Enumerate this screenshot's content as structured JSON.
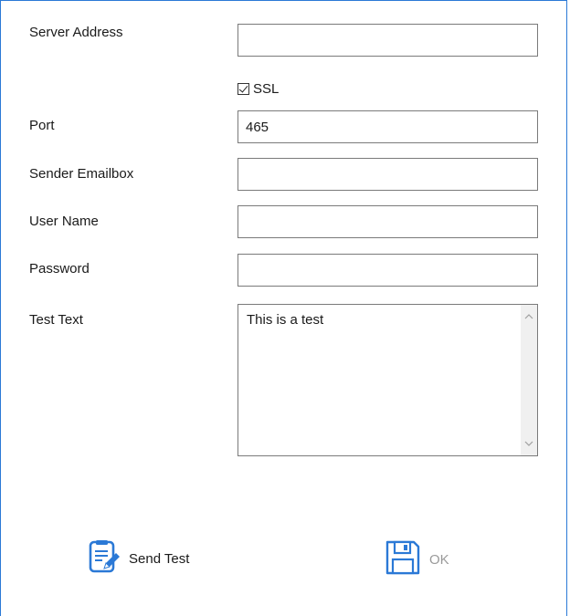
{
  "form": {
    "server_address": {
      "label": "Server Address",
      "value": ""
    },
    "ssl": {
      "label": "SSL",
      "checked": true
    },
    "port": {
      "label": "Port",
      "value": "465"
    },
    "sender_emailbox": {
      "label": "Sender Emailbox",
      "value": ""
    },
    "user_name": {
      "label": "User Name",
      "value": ""
    },
    "password": {
      "label": "Password",
      "value": ""
    },
    "test_text": {
      "label": "Test Text",
      "value": "This is a test"
    }
  },
  "buttons": {
    "send_test": {
      "label": "Send Test",
      "icon": "edit-document-icon",
      "enabled": true
    },
    "ok": {
      "label": "OK",
      "icon": "floppy-disk-icon",
      "enabled": false
    }
  },
  "colors": {
    "accent": "#2b79d6",
    "disabled_text": "#9a9a9a"
  }
}
